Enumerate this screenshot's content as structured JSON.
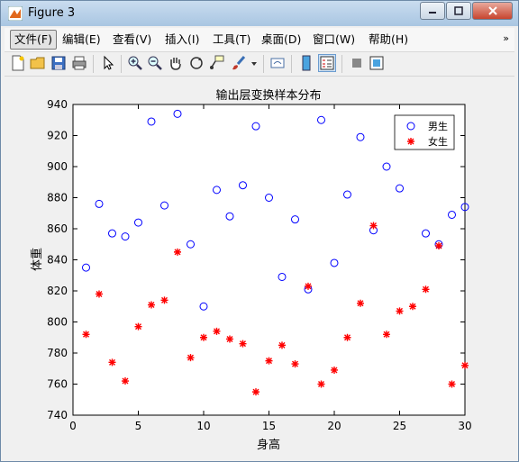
{
  "window": {
    "title": "Figure 3"
  },
  "menu": {
    "items": [
      "文件(F)",
      "编辑(E)",
      "查看(V)",
      "插入(I)",
      "工具(T)",
      "桌面(D)",
      "窗口(W)",
      "帮助(H)"
    ],
    "overflow_arrow": "»"
  },
  "toolbar": {
    "icons": [
      "new-figure-icon",
      "open-file-icon",
      "save-icon",
      "print-icon",
      "pointer-icon",
      "zoom-in-icon",
      "zoom-out-icon",
      "pan-hand-icon",
      "rotate-3d-icon",
      "data-cursor-icon",
      "brush-icon",
      "brush-dropdown-icon",
      "link-plot-icon",
      "colorbar-icon",
      "legend-icon",
      "hide-plot-tools-icon",
      "show-plot-tools-icon"
    ]
  },
  "colors": {
    "male": "#0000ff",
    "female": "#ff0000",
    "titlebar": "#b9d1ea"
  },
  "chart_data": {
    "type": "scatter",
    "title": "输出层变换样本分布",
    "xlabel": "身高",
    "ylabel": "体重",
    "xlim": [
      0,
      30
    ],
    "ylim": [
      740,
      940
    ],
    "xticks": [
      0,
      5,
      10,
      15,
      20,
      25,
      30
    ],
    "yticks": [
      740,
      760,
      780,
      800,
      820,
      840,
      860,
      880,
      900,
      920,
      940
    ],
    "grid": false,
    "legend_position": "top-right",
    "series": [
      {
        "name": "男生",
        "marker": "circle",
        "color": "#0000ff",
        "points": [
          [
            1,
            835
          ],
          [
            2,
            876
          ],
          [
            3,
            857
          ],
          [
            4,
            855
          ],
          [
            5,
            864
          ],
          [
            6,
            929
          ],
          [
            7,
            875
          ],
          [
            8,
            934
          ],
          [
            9,
            850
          ],
          [
            10,
            810
          ],
          [
            11,
            885
          ],
          [
            12,
            868
          ],
          [
            13,
            888
          ],
          [
            14,
            926
          ],
          [
            15,
            880
          ],
          [
            16,
            829
          ],
          [
            17,
            866
          ],
          [
            18,
            821
          ],
          [
            19,
            930
          ],
          [
            20,
            838
          ],
          [
            21,
            882
          ],
          [
            22,
            919
          ],
          [
            23,
            859
          ],
          [
            24,
            900
          ],
          [
            25,
            886
          ],
          [
            27,
            857
          ],
          [
            28,
            850
          ],
          [
            29,
            869
          ],
          [
            30,
            874
          ]
        ]
      },
      {
        "name": "女生",
        "marker": "asterisk",
        "color": "#ff0000",
        "points": [
          [
            1,
            792
          ],
          [
            2,
            818
          ],
          [
            3,
            774
          ],
          [
            4,
            762
          ],
          [
            5,
            797
          ],
          [
            6,
            811
          ],
          [
            7,
            814
          ],
          [
            8,
            845
          ],
          [
            9,
            777
          ],
          [
            10,
            790
          ],
          [
            11,
            794
          ],
          [
            12,
            789
          ],
          [
            13,
            786
          ],
          [
            14,
            755
          ],
          [
            15,
            775
          ],
          [
            16,
            785
          ],
          [
            17,
            773
          ],
          [
            18,
            823
          ],
          [
            19,
            760
          ],
          [
            20,
            769
          ],
          [
            21,
            790
          ],
          [
            22,
            812
          ],
          [
            23,
            862
          ],
          [
            24,
            792
          ],
          [
            25,
            807
          ],
          [
            26,
            810
          ],
          [
            27,
            821
          ],
          [
            28,
            849
          ],
          [
            29,
            760
          ],
          [
            30,
            772
          ]
        ]
      }
    ]
  }
}
